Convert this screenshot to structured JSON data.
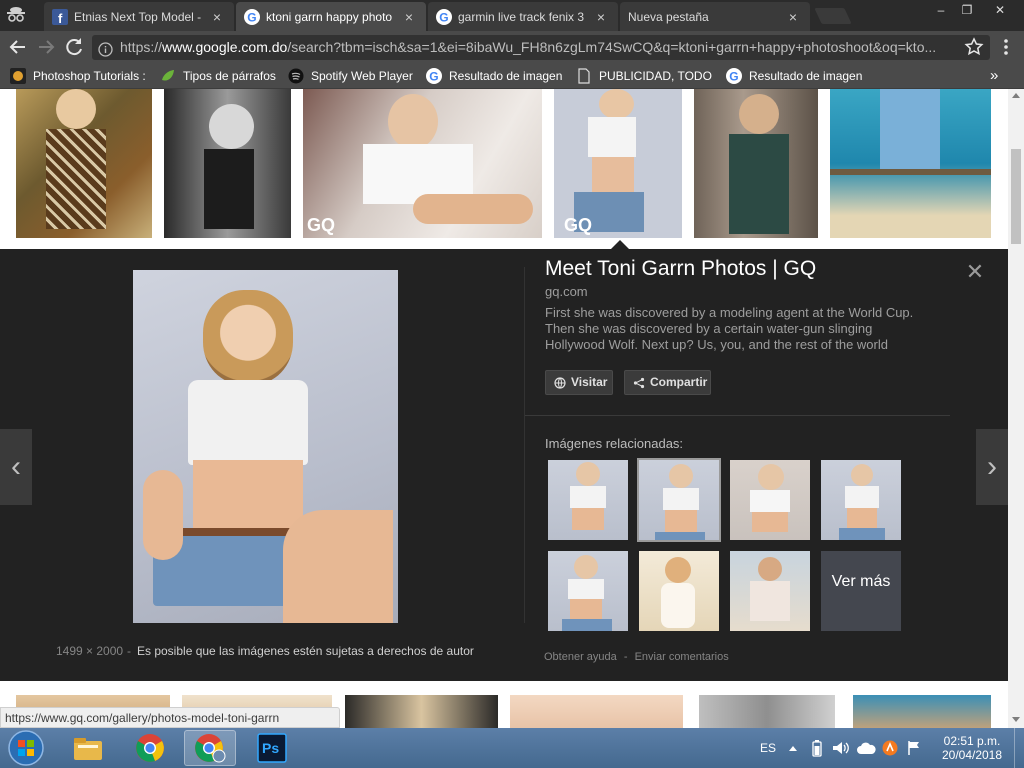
{
  "browser": {
    "tabs": [
      {
        "title": "Etnias Next Top Model -",
        "favicon": "facebook-icon",
        "active": false
      },
      {
        "title": "ktoni garrn happy photo",
        "favicon": "google-icon",
        "active": true
      },
      {
        "title": "garmin live track fenix 3",
        "favicon": "google-icon",
        "active": false
      },
      {
        "title": "Nueva pestaña",
        "favicon": "none",
        "active": false
      }
    ],
    "close_glyph": "×",
    "window_controls": {
      "minimize": "–",
      "restore": "❐",
      "close": "✕"
    },
    "url_scheme": "https://",
    "url_host": "www.google.com.do",
    "url_path": "/search?tbm=isch&sa=1&ei=8ibaWu_FH8n6zgLm74SwCQ&q=ktoni+garrn+happy+photoshoot&oq=kto...",
    "bookmarks": [
      {
        "label": "Photoshop Tutorials :",
        "icon": "photoshop-tutorials-icon"
      },
      {
        "label": "Tipos de párrafos",
        "icon": "leaf-icon"
      },
      {
        "label": "Spotify Web Player",
        "icon": "spotify-icon"
      },
      {
        "label": "Resultado de imagen",
        "icon": "google-icon"
      },
      {
        "label": "PUBLICIDAD, TODO S",
        "icon": "page-icon"
      },
      {
        "label": "Resultado de imagen",
        "icon": "google-icon"
      }
    ],
    "more_bookmarks": "»",
    "status_url": "https://www.gq.com/gallery/photos-model-toni-garrn"
  },
  "preview": {
    "title": "Meet Toni Garrn Photos | GQ",
    "domain": "gq.com",
    "description": "First she was discovered by a modeling agent at the World Cup. Then she was discovered by a certain water-gun slinging Hollywood Wolf. Next up? Us, you, and the rest of the world",
    "visit_label": "Visitar",
    "share_label": "Compartir",
    "related_label": "Imágenes relacionadas:",
    "see_more_label": "Ver más",
    "size": "1499 × 2000",
    "separator": "-",
    "copyright": "Es posible que las imágenes estén sujetas a derechos de autor",
    "help_label": "Obtener ayuda",
    "feedback_label": "Enviar comentarios",
    "close_glyph": "✕",
    "prev_glyph": "‹",
    "next_glyph": "›"
  },
  "thumb_watermark": "GQ",
  "taskbar": {
    "apps": [
      "start-button",
      "file-explorer-icon",
      "chrome-icon",
      "chrome-profile-icon",
      "photoshop-icon"
    ],
    "photoshop_label": "Ps",
    "language": "ES",
    "time": "02:51 p.m.",
    "date": "20/04/2018"
  }
}
